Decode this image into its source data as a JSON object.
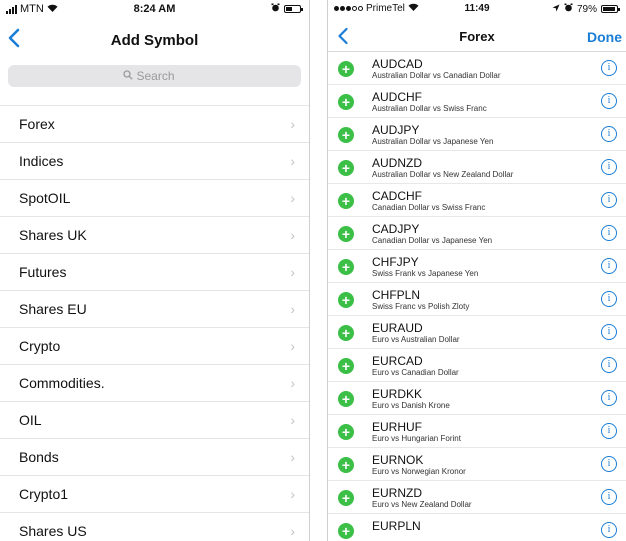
{
  "left": {
    "status": {
      "carrier": "MTN",
      "time": "8:24 AM"
    },
    "nav": {
      "back_icon": "chevron-left-icon",
      "title": "Add Symbol"
    },
    "search": {
      "placeholder": "Search"
    },
    "categories": [
      {
        "label": "Forex"
      },
      {
        "label": "Indices"
      },
      {
        "label": "SpotOIL"
      },
      {
        "label": "Shares UK"
      },
      {
        "label": "Futures"
      },
      {
        "label": "Shares EU"
      },
      {
        "label": "Crypto"
      },
      {
        "label": "Commodities."
      },
      {
        "label": "OIL"
      },
      {
        "label": "Bonds"
      },
      {
        "label": "Crypto1"
      },
      {
        "label": "Shares US"
      }
    ]
  },
  "right": {
    "status": {
      "carrier": "PrimeTel",
      "time": "11:49",
      "battery": "79%"
    },
    "nav": {
      "title": "Forex",
      "done_label": "Done"
    },
    "symbols": [
      {
        "code": "AUDCAD",
        "desc": "Australian Dollar vs Canadian Dollar"
      },
      {
        "code": "AUDCHF",
        "desc": "Australian Dollar vs Swiss Franc"
      },
      {
        "code": "AUDJPY",
        "desc": "Australian Dollar vs Japanese Yen"
      },
      {
        "code": "AUDNZD",
        "desc": "Australian Dollar vs New Zealand Dollar"
      },
      {
        "code": "CADCHF",
        "desc": "Canadian Dollar vs Swiss Franc"
      },
      {
        "code": "CADJPY",
        "desc": "Canadian Dollar vs Japanese Yen"
      },
      {
        "code": "CHFJPY",
        "desc": "Swiss Frank vs Japanese Yen"
      },
      {
        "code": "CHFPLN",
        "desc": "Swiss Franc vs Polish Zloty"
      },
      {
        "code": "EURAUD",
        "desc": "Euro vs Australian Dollar"
      },
      {
        "code": "EURCAD",
        "desc": "Euro vs Canadian Dollar"
      },
      {
        "code": "EURDKK",
        "desc": "Euro vs Danish Krone"
      },
      {
        "code": "EURHUF",
        "desc": "Euro vs Hungarian Forint"
      },
      {
        "code": "EURNOK",
        "desc": "Euro vs Norwegian Kronor"
      },
      {
        "code": "EURNZD",
        "desc": "Euro vs New Zealand Dollar"
      },
      {
        "code": "EURPLN",
        "desc": ""
      }
    ]
  },
  "colors": {
    "accent": "#1a7dd6",
    "add": "#3bbf46"
  }
}
